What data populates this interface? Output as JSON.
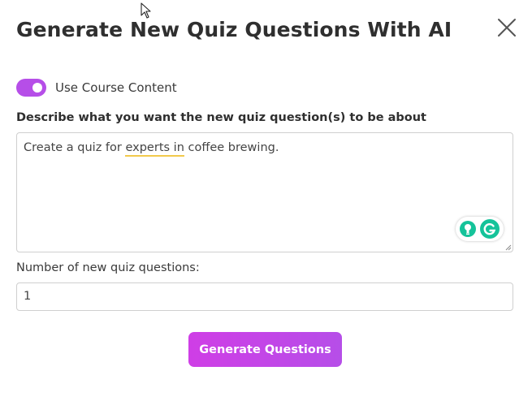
{
  "dialog": {
    "title": "Generate New Quiz Questions With AI"
  },
  "toggle": {
    "label": "Use Course Content",
    "checked": true,
    "color": "#b64ee8"
  },
  "prompt": {
    "label": "Describe what you want the new quiz question(s) to be about",
    "text_before": "Create a quiz for ",
    "text_underlined": "experts in",
    "text_after": " coffee brewing."
  },
  "count": {
    "label": "Number of new quiz questions:",
    "value": "1"
  },
  "generate_button": {
    "label": "Generate Questions",
    "color": "#cf3ee6"
  },
  "icons": {
    "close": "close-icon",
    "cursor": "mouse-cursor-icon",
    "grammarly_suggest": "lightbulb-icon",
    "grammarly_logo": "grammarly-icon"
  }
}
